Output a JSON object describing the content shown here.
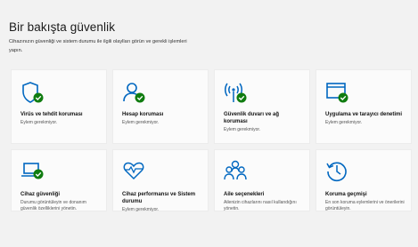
{
  "page": {
    "title": "Bir bakışta güvenlik",
    "description": "Cihazınızın güvenliği ve sistem durumu ile ilgili olaylları görün ve gerekli işlemleri yapın."
  },
  "cards": [
    {
      "icon": "virus-shield-icon",
      "title": "Virüs ve tehdit koruması",
      "subtitle": "Eylem gerekmiyor.",
      "status": "ok"
    },
    {
      "icon": "account-person-icon",
      "title": "Hesap koruması",
      "subtitle": "Eylem gerekmiyor.",
      "status": "ok"
    },
    {
      "icon": "firewall-antenna-icon",
      "title": "Güvenlik duvarı ve ağ koruması",
      "subtitle": "Eylem gerekmiyor.",
      "status": "ok"
    },
    {
      "icon": "app-browser-window-icon",
      "title": "Uygulama ve tarayıcı denetimi",
      "subtitle": "Eylem gerekmiyor.",
      "status": "ok"
    },
    {
      "icon": "laptop-icon",
      "title": "Cihaz güvenliği",
      "subtitle": "Durumu görüntüleyin ve donanım güvenlik özelliklerini yönetin.",
      "status": "ok"
    },
    {
      "icon": "heart-pulse-icon",
      "title": "Cihaz performansı ve Sistem durumu",
      "subtitle": "Eylem gerekmiyor.",
      "status": "ok"
    },
    {
      "icon": "family-people-icon",
      "title": "Aile seçenekleri",
      "subtitle": "Ailenizin cihazlarını nasıl kullandığını yönetin.",
      "status": "none"
    },
    {
      "icon": "history-clock-icon",
      "title": "Koruma geçmişi",
      "subtitle": "En son koruma eylemlerini ve önerilerini görüntüleyin.",
      "status": "none"
    }
  ],
  "colors": {
    "accent": "#0067c0",
    "ok": "#107c10",
    "background": "#f2f2f2",
    "card": "#fbfbfb"
  }
}
